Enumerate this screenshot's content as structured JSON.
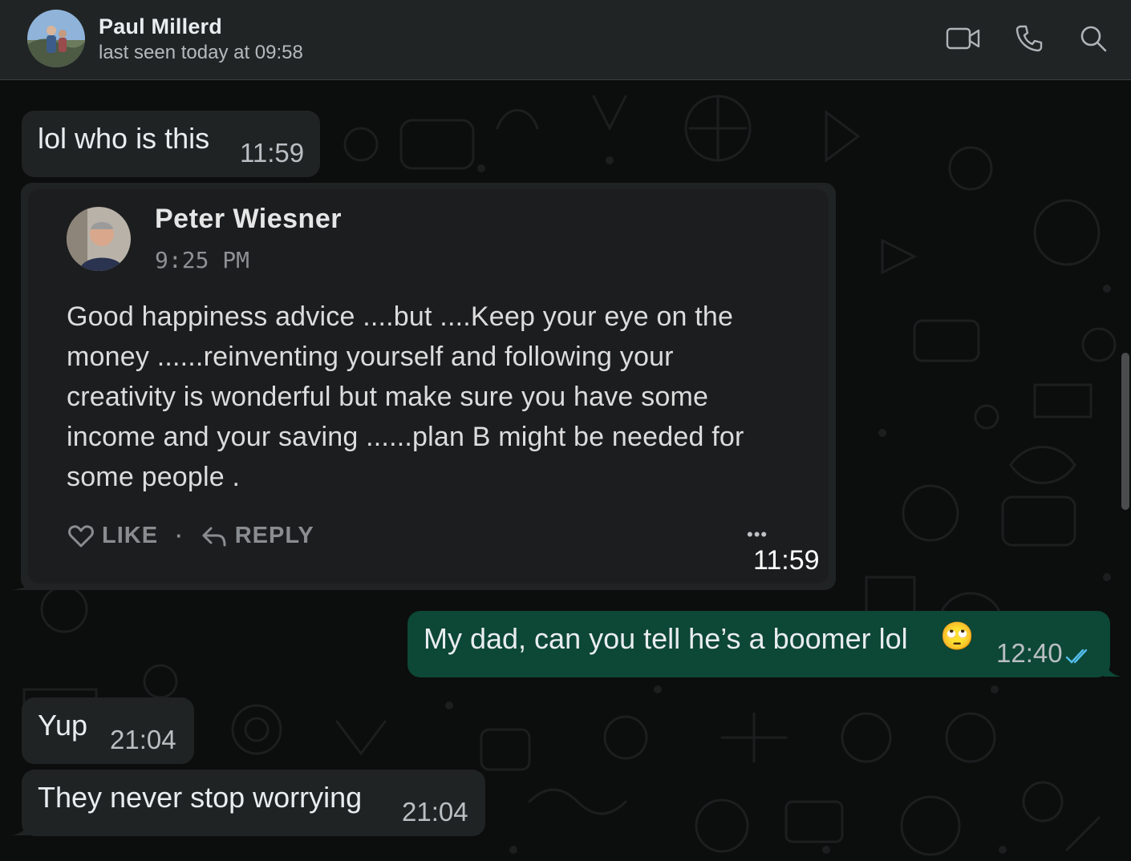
{
  "header": {
    "contact_name": "Paul Millerd",
    "status": "last seen today at 09:58",
    "icons": [
      "video-call-icon",
      "voice-call-icon",
      "search-icon"
    ]
  },
  "messages": [
    {
      "direction": "incoming",
      "text": "lol who is this",
      "time": "11:59"
    },
    {
      "direction": "incoming",
      "type": "shared_post",
      "time": "11:59",
      "post": {
        "author": "Peter Wiesner",
        "time": "9:25 PM",
        "body_lines": [
          "Good happiness advice ....but ....Keep your eye on the",
          "money ......reinventing yourself and following your",
          "creativity is wonderful but make sure you have some",
          "income and your saving ......plan B might be needed for",
          "some people ."
        ],
        "like_label": "LIKE",
        "separator": "·",
        "reply_label": "REPLY",
        "more": "•••"
      }
    },
    {
      "direction": "outgoing",
      "text": "My dad, can you tell he’s a boomer lol",
      "emoji": "🙄",
      "time": "12:40",
      "status": "read"
    },
    {
      "direction": "incoming",
      "text": "Yup",
      "time": "21:04"
    },
    {
      "direction": "incoming",
      "text": "They never stop worrying",
      "time": "21:04"
    }
  ],
  "colors": {
    "header_bg": "#212425",
    "incoming_bubble": "#202324",
    "outgoing_bubble": "#0d4735",
    "read_ticks": "#53bdeb"
  }
}
